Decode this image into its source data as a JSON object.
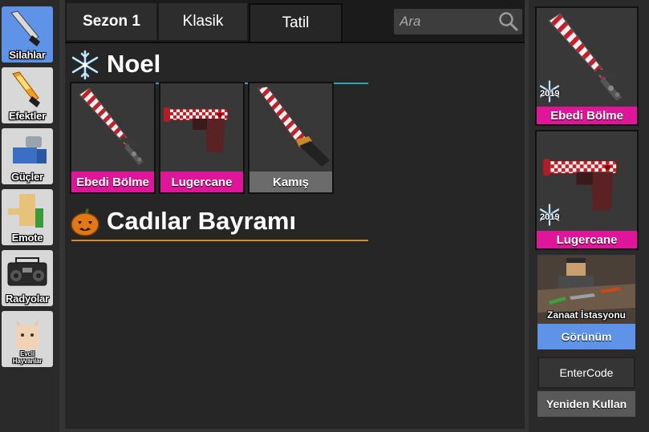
{
  "sidebar": {
    "items": [
      {
        "label": "Silahlar",
        "icon": "knife-icon",
        "active": true
      },
      {
        "label": "Efektler",
        "icon": "flame-knife-icon",
        "active": false
      },
      {
        "label": "Güçler",
        "icon": "character-power-icon",
        "active": false
      },
      {
        "label": "Emote",
        "icon": "character-emote-icon",
        "active": false
      },
      {
        "label": "Radyolar",
        "icon": "boombox-icon",
        "active": false
      },
      {
        "label_line1": "Evcil",
        "label_line2": "Hayvanlar",
        "icon": "pet-cat-icon",
        "active": false
      }
    ]
  },
  "tabs": [
    {
      "label": "Sezon 1",
      "bold": true,
      "active": false
    },
    {
      "label": "Klasik",
      "bold": false,
      "active": false
    },
    {
      "label": "Tatil",
      "bold": false,
      "active": true
    }
  ],
  "search": {
    "placeholder": "Ara",
    "icon": "search-icon"
  },
  "sections": [
    {
      "title": "Noel",
      "icon": "snowflake-icon",
      "rule_color": "#2aa5b5",
      "items": [
        {
          "name": "Ebedi Bölme",
          "icon": "candy-cane-sword-icon",
          "rarity_color": "#e0169a"
        },
        {
          "name": "Lugercane",
          "icon": "candy-cane-pistol-icon",
          "rarity_color": "#e0169a"
        },
        {
          "name": "Kamış",
          "icon": "candy-cane-knife-icon",
          "rarity_color": "#6b6b6b"
        }
      ]
    },
    {
      "title": "Cadılar Bayramı",
      "icon": "pumpkin-icon",
      "rule_color": "#e08a1e",
      "items": []
    }
  ],
  "equipped": [
    {
      "name": "Ebedi Bölme",
      "year": "2019",
      "icon": "candy-cane-sword-icon"
    },
    {
      "name": "Lugercane",
      "year": "2019",
      "icon": "candy-cane-pistol-icon"
    }
  ],
  "crafting": {
    "label": "Zanaat İstasyonu"
  },
  "buttons": {
    "view": "Görünüm",
    "enter_code": "EnterCode",
    "reuse": "Yeniden Kullan"
  },
  "colors": {
    "accent_blue": "#5e93e8",
    "godly_pink": "#e0169a"
  }
}
